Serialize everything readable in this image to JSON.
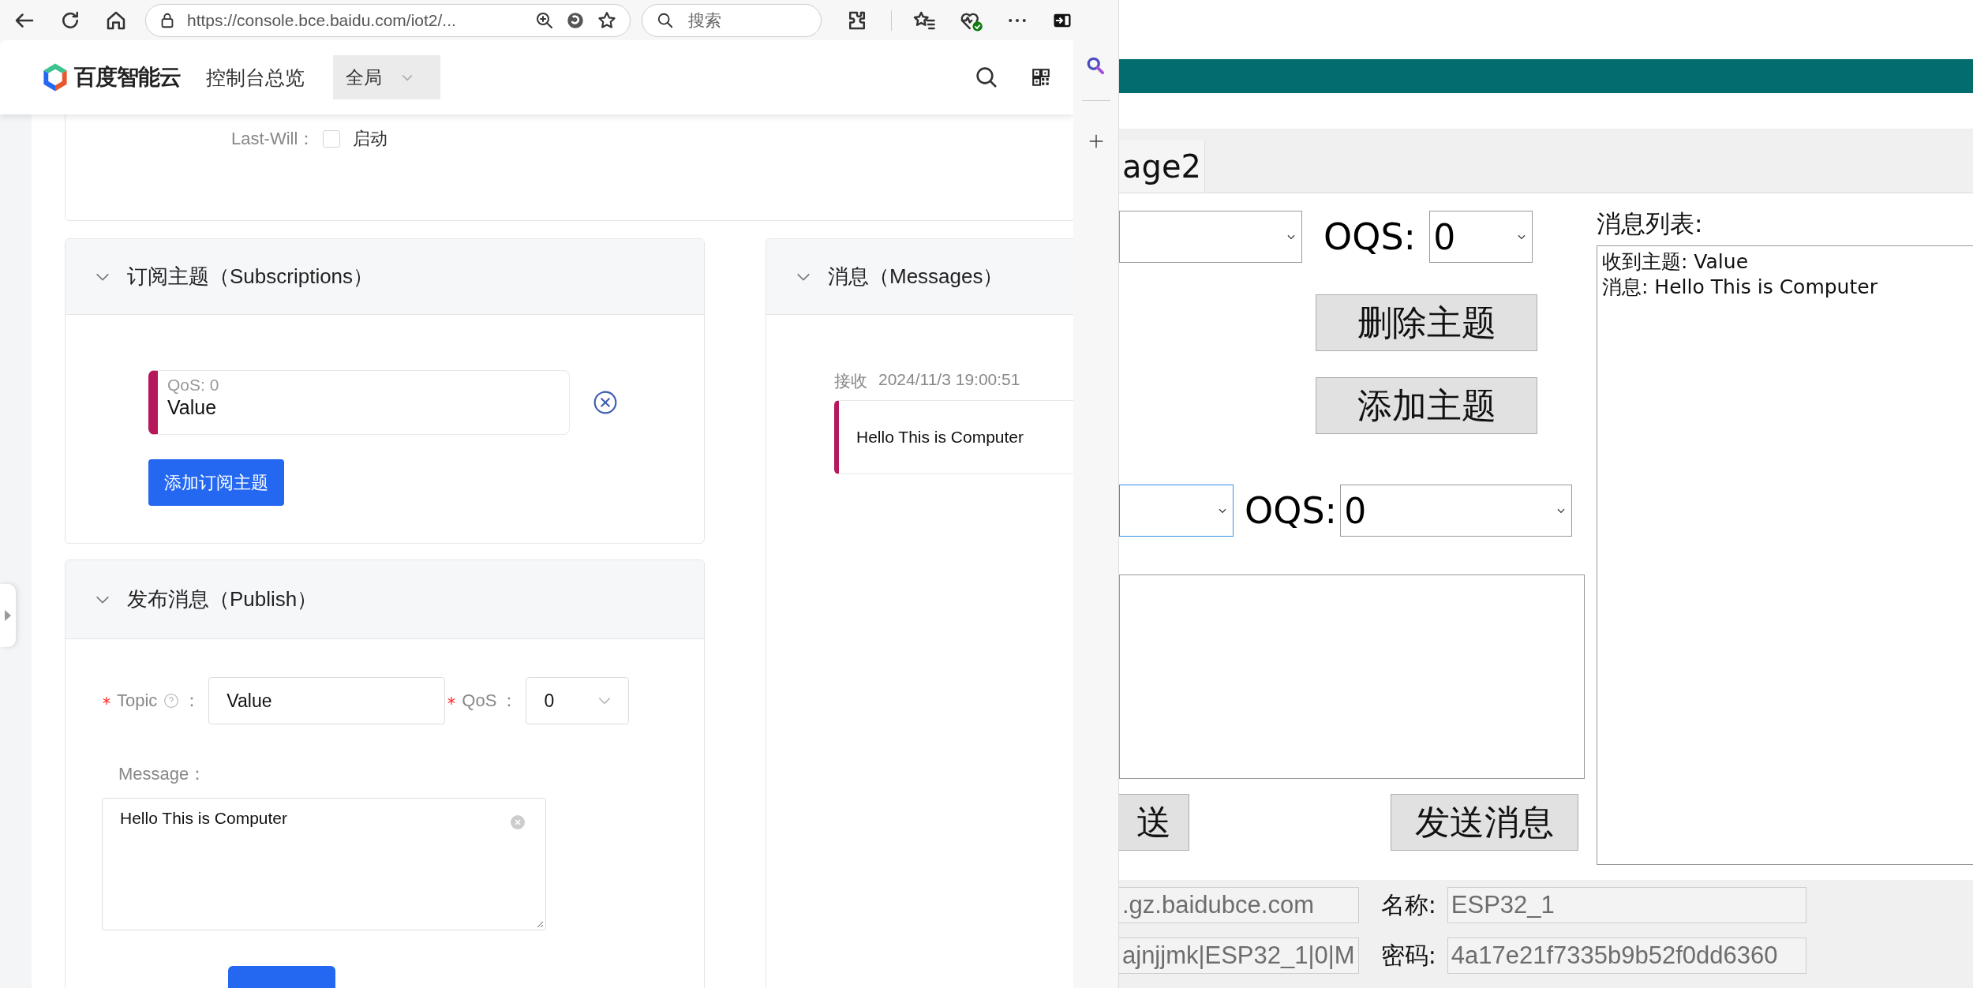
{
  "browser": {
    "url": "https://console.bce.baidu.com/iot2/...",
    "search_placeholder": "搜索"
  },
  "console": {
    "brand": "百度智能云",
    "nav_title": "控制台总览",
    "region": "全局",
    "last_will": {
      "label": "Last-Will：",
      "option": "启动",
      "checked": false
    },
    "subscriptions": {
      "title": "订阅主题（Subscriptions）",
      "expanded": true,
      "items": [
        {
          "qos": "QoS: 0",
          "topic": "Value"
        }
      ],
      "add_button": "添加订阅主题"
    },
    "messages": {
      "title": "消息（Messages）",
      "expanded": true,
      "items": [
        {
          "direction": "接收",
          "time": "2024/11/3 19:00:51",
          "text": "Hello This is Computer"
        }
      ]
    },
    "publish": {
      "title": "发布消息（Publish）",
      "expanded": true,
      "topic": {
        "label": "Topic",
        "required": true,
        "colon": "：",
        "value": "Value"
      },
      "qos": {
        "label": "QoS",
        "required": true,
        "colon": "：",
        "value": "0"
      },
      "message": {
        "label": "Message：",
        "value": "Hello This is Computer"
      }
    }
  },
  "app": {
    "tab": "age2",
    "subscribe_row": {
      "topic": {
        "focused": false
      },
      "qos_label": "OQS:",
      "qos": {
        "value": "0"
      }
    },
    "buttons": [
      "删除主题",
      "添加主题"
    ],
    "publish_row": {
      "topic": {
        "focused": true
      },
      "qos_label": "OQS:",
      "qos": {
        "value": "0"
      }
    },
    "send_buttons": [
      "送",
      "发送消息"
    ],
    "list_label": "消息列表:",
    "list_lines": [
      "收到主题: Value",
      "消息: Hello This is Computer"
    ],
    "host": ".gz.baidubce.com",
    "client_id": "ajnjjmk|ESP32_1|0|M",
    "name_label": "名称:",
    "name_value": "ESP32_1",
    "password_label": "密码:",
    "password_value": "4a17e21f7335b9b52f0dd6360"
  }
}
